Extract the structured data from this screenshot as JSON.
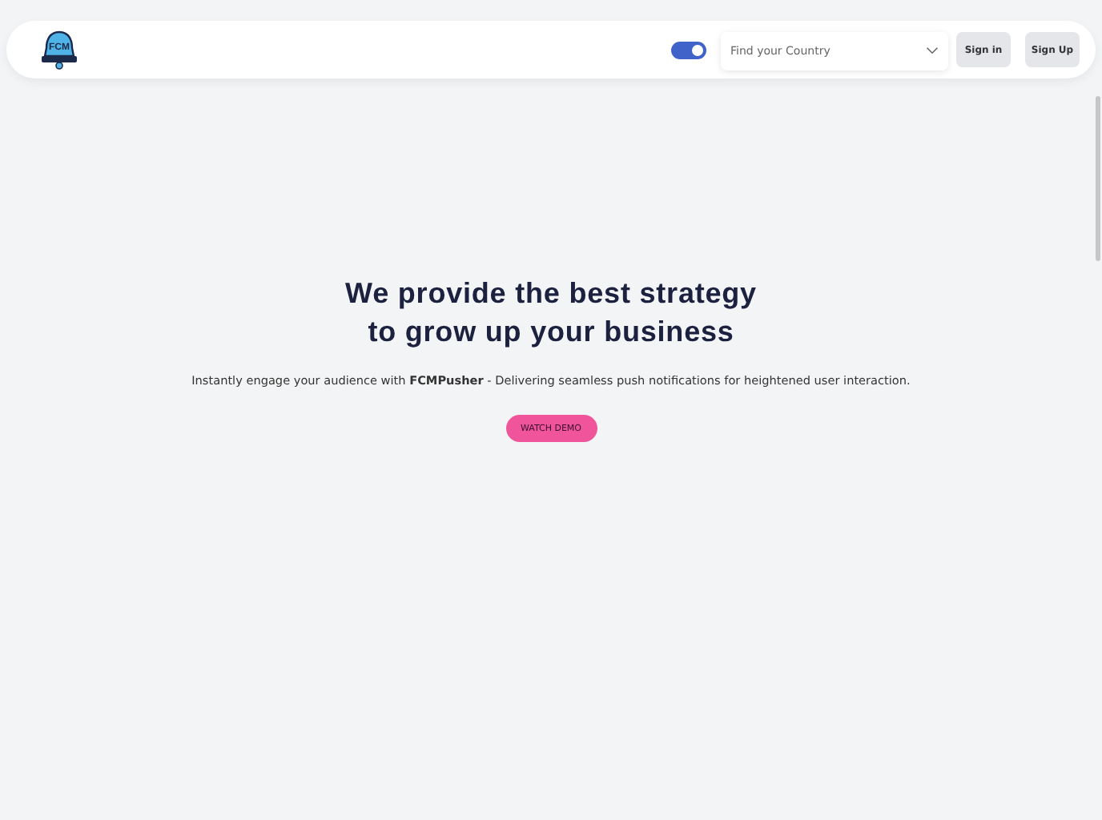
{
  "header": {
    "logo_text": "FCM",
    "toggle": {
      "on": true
    },
    "country_select": {
      "placeholder": "Find your Country"
    },
    "buttons": [
      "Sign in",
      "Sign Up"
    ]
  },
  "hero": {
    "title_lines": [
      "We provide the best strategy",
      "to grow up your business"
    ],
    "subtitle": "Instantly engage your audience with **FCMPusher** - Delivering seamless push notifications for heightened user interaction.",
    "cta": "WATCH DEMO"
  }
}
